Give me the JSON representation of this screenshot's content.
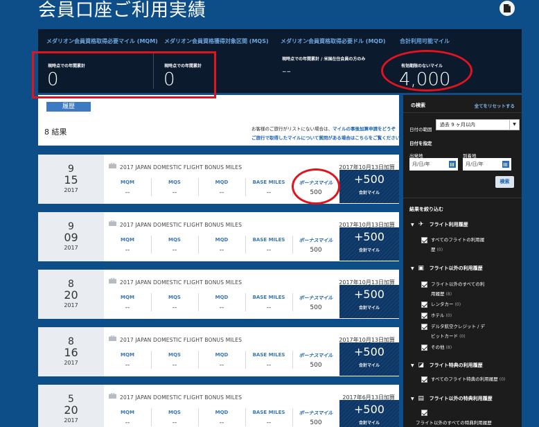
{
  "page": {
    "title": "会員口座ご利用実績"
  },
  "summary": {
    "columns": [
      {
        "head": "メダリオン会員資格取得必要マイル (MQM)",
        "sub": "現時点での年間累計",
        "value": "0"
      },
      {
        "head": "メダリオン会員資格獲得対象区間 (MQS)",
        "sub": "現時点での年間累計",
        "value": "0"
      },
      {
        "head": "メダリオン会員資格取得必要ドル (MQD)",
        "sub": "現時点での年間累計 / 米国在住会員の方のみ",
        "value": "--"
      },
      {
        "head": "合計利用可能マイル",
        "sub": "有効期限のないマイル",
        "value": "4,000"
      }
    ]
  },
  "results": {
    "tab_label": "履歴",
    "count": "8 結果",
    "note_line1": "お客様のご旅行がリストにない場合は、",
    "note_link1": "マイルの事後加算申請をどうぞ",
    "note_link2": "ご旅行で取得したマイルについて質問がある場合はこちらをご覧ください"
  },
  "metric_labels": {
    "mqm": "MQM",
    "mqs": "MQS",
    "mqd": "MQD",
    "base": "BASE MILES",
    "bonus": "ボーナスマイル",
    "total_sub": "合計マイル"
  },
  "rows": [
    {
      "month": "9",
      "day": "15",
      "year": "2017",
      "title": "2017 JAPAN DOMESTIC FLIGHT BONUS MILES",
      "posted": "2017年10月13日加算",
      "mqm": "--",
      "mqs": "--",
      "mqd": "--",
      "base": "--",
      "bonus": "500",
      "total": "+500"
    },
    {
      "month": "9",
      "day": "09",
      "year": "2017",
      "title": "2017 JAPAN DOMESTIC FLIGHT BONUS MILES",
      "posted": "2017年10月13日加算",
      "mqm": "--",
      "mqs": "--",
      "mqd": "--",
      "base": "--",
      "bonus": "500",
      "total": "+500"
    },
    {
      "month": "8",
      "day": "20",
      "year": "2017",
      "title": "2017 JAPAN DOMESTIC FLIGHT BONUS MILES",
      "posted": "2017年10月13日加算",
      "mqm": "--",
      "mqs": "--",
      "mqd": "--",
      "base": "--",
      "bonus": "500",
      "total": "+500"
    },
    {
      "month": "8",
      "day": "16",
      "year": "2017",
      "title": "2017 JAPAN DOMESTIC FLIGHT BONUS MILES",
      "posted": "2017年10月13日加算",
      "mqm": "--",
      "mqs": "--",
      "mqd": "--",
      "base": "--",
      "bonus": "500",
      "total": "+500"
    },
    {
      "month": "5",
      "day": "20",
      "year": "2017",
      "title": "2017 JAPAN DOMESTIC FLIGHT BONUS MILES",
      "posted": "2017年6月13日加算",
      "mqm": "--",
      "mqs": "--",
      "mqd": "--",
      "base": "--",
      "bonus": "500",
      "total": "+500"
    }
  ],
  "sidebar": {
    "title": "の検索",
    "reset": "全てをリセットする",
    "range_label": "日付の範囲",
    "range_value": "過去 9 ヶ月以内",
    "specify_label": "日付を指定",
    "from_label": "出発地",
    "to_label": "到着地",
    "date_placeholder": "月/日/年",
    "search_button": "検索",
    "narrow_label": "結果を絞り込む",
    "groups": [
      {
        "label": "フライト利用履歴",
        "icon": "airplane-icon",
        "items": [
          {
            "text": "すべてのフライトの利用履",
            "text2": "歴",
            "count": "(0)"
          }
        ]
      },
      {
        "label": "フライト以外の利用履歴",
        "icon": "briefcase-icon",
        "items": [
          {
            "text": "フライト以外のすべての利",
            "text2": "用履歴",
            "count": "(8)"
          },
          {
            "text": "レンタカー",
            "count": "(0)"
          },
          {
            "text": "ホテル",
            "count": "(0)"
          },
          {
            "text": "デルタ航空クレジット / デ",
            "text2": "ビットカード",
            "count": "(0)"
          },
          {
            "text": "その他",
            "count": "(8)"
          }
        ]
      },
      {
        "label": "フライト特典の利用履歴",
        "icon": "flight-award-icon",
        "items": [
          {
            "text": "すべてのフライト特典の利用履歴",
            "count": "(0)"
          }
        ]
      },
      {
        "label": "フライト以外の特典利用履歴",
        "icon": "gift-icon",
        "items": [
          {
            "text": "フライト以外のすべての特典利用履歴",
            "count": ""
          }
        ]
      }
    ]
  }
}
